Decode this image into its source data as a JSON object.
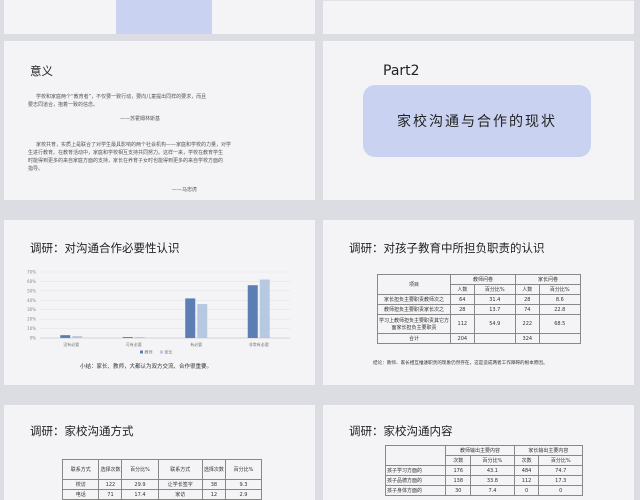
{
  "slide2": {
    "title": "意义",
    "quote1": [
      "学校和家庭两个“教育者”，不仅要一致行动，要向儿童提出同样的要求，而且",
      "要志同道合，抱着一致的信念。"
    ],
    "author1": "——苏霍姆林斯基",
    "quote2": [
      "家校共育，实质上是联合了对学生最具影响的两个社会机构——家庭和学校的力量，对学",
      "生进行教育。在教育活动中，家庭和学校相互支持共同努力。这样一来，学校在教育学生",
      "时能得到更多的来自家庭方面的支持，家长在养育子女时也能得到更多的来自学校方面的",
      "指导。"
    ],
    "author2": "——马忠虎"
  },
  "slide3": {
    "part": "Part2",
    "heading": "家校沟通与合作的现状"
  },
  "slide4": {
    "title": "调研：对沟通合作必要性认识",
    "caption": "小结：家长、教师，大都认为双方交流、合作很重要。",
    "chart_data": {
      "type": "bar",
      "categories": [
        "没有必要",
        "可有必要",
        "有必要",
        "非常有必要"
      ],
      "series": [
        {
          "name": "教师",
          "values": [
            3,
            1,
            42,
            56
          ],
          "color": "#5b7fb4"
        },
        {
          "name": "家长",
          "values": [
            2,
            1,
            36,
            62
          ],
          "color": "#b7c8e2"
        }
      ],
      "ylim": [
        0,
        70
      ],
      "yticks": [
        "0%",
        "10%",
        "20%",
        "30%",
        "40%",
        "50%",
        "60%",
        "70%"
      ]
    }
  },
  "slide5": {
    "title": "调研：对孩子教育中所担负职责的认识",
    "header": [
      "项目",
      "教师问卷",
      "家长问卷"
    ],
    "subheader": [
      "人数",
      "百分比%",
      "人数",
      "百分比%"
    ],
    "rows": [
      [
        "家长担负主要职责教师次之",
        "64",
        "31.4",
        "28",
        "8.6"
      ],
      [
        "教师担负主要职责家长次之",
        "28",
        "13.7",
        "74",
        "22.8"
      ],
      [
        "学习上教师担负主要职责其它方面家长担负主要职责",
        "112",
        "54.9",
        "222",
        "68.5"
      ],
      [
        "合计",
        "204",
        "",
        "324",
        ""
      ]
    ],
    "note": "结论：教师、家长相互推诿职责的现象仍然存在，这是造成两者工作障碍的根本原因。"
  },
  "slide6": {
    "title": "调研：家校沟通方式",
    "header": [
      "联系方式",
      "选择次数",
      "百分比%",
      "联系方式",
      "选择次数",
      "百分比%"
    ],
    "rows": [
      [
        "校访",
        "122",
        "29.9",
        "让学长签字",
        "38",
        "9.3"
      ],
      [
        "电话",
        "71",
        "17.4",
        "家访",
        "12",
        "2.9"
      ]
    ]
  },
  "slide7": {
    "title": "调研：家校沟通内容",
    "header": [
      "",
      "教师输出主要内容",
      "家长输出主要内容"
    ],
    "subheader": [
      "次数",
      "百分比%",
      "次数",
      "百分比%"
    ],
    "rows": [
      [
        "孩子学习方面的",
        "176",
        "43.1",
        "484",
        "74.7"
      ],
      [
        "孩子品德方面的",
        "138",
        "33.8",
        "112",
        "17.3"
      ],
      [
        "孩子身体方面的",
        "30",
        "7.4",
        "0",
        "0"
      ]
    ]
  }
}
